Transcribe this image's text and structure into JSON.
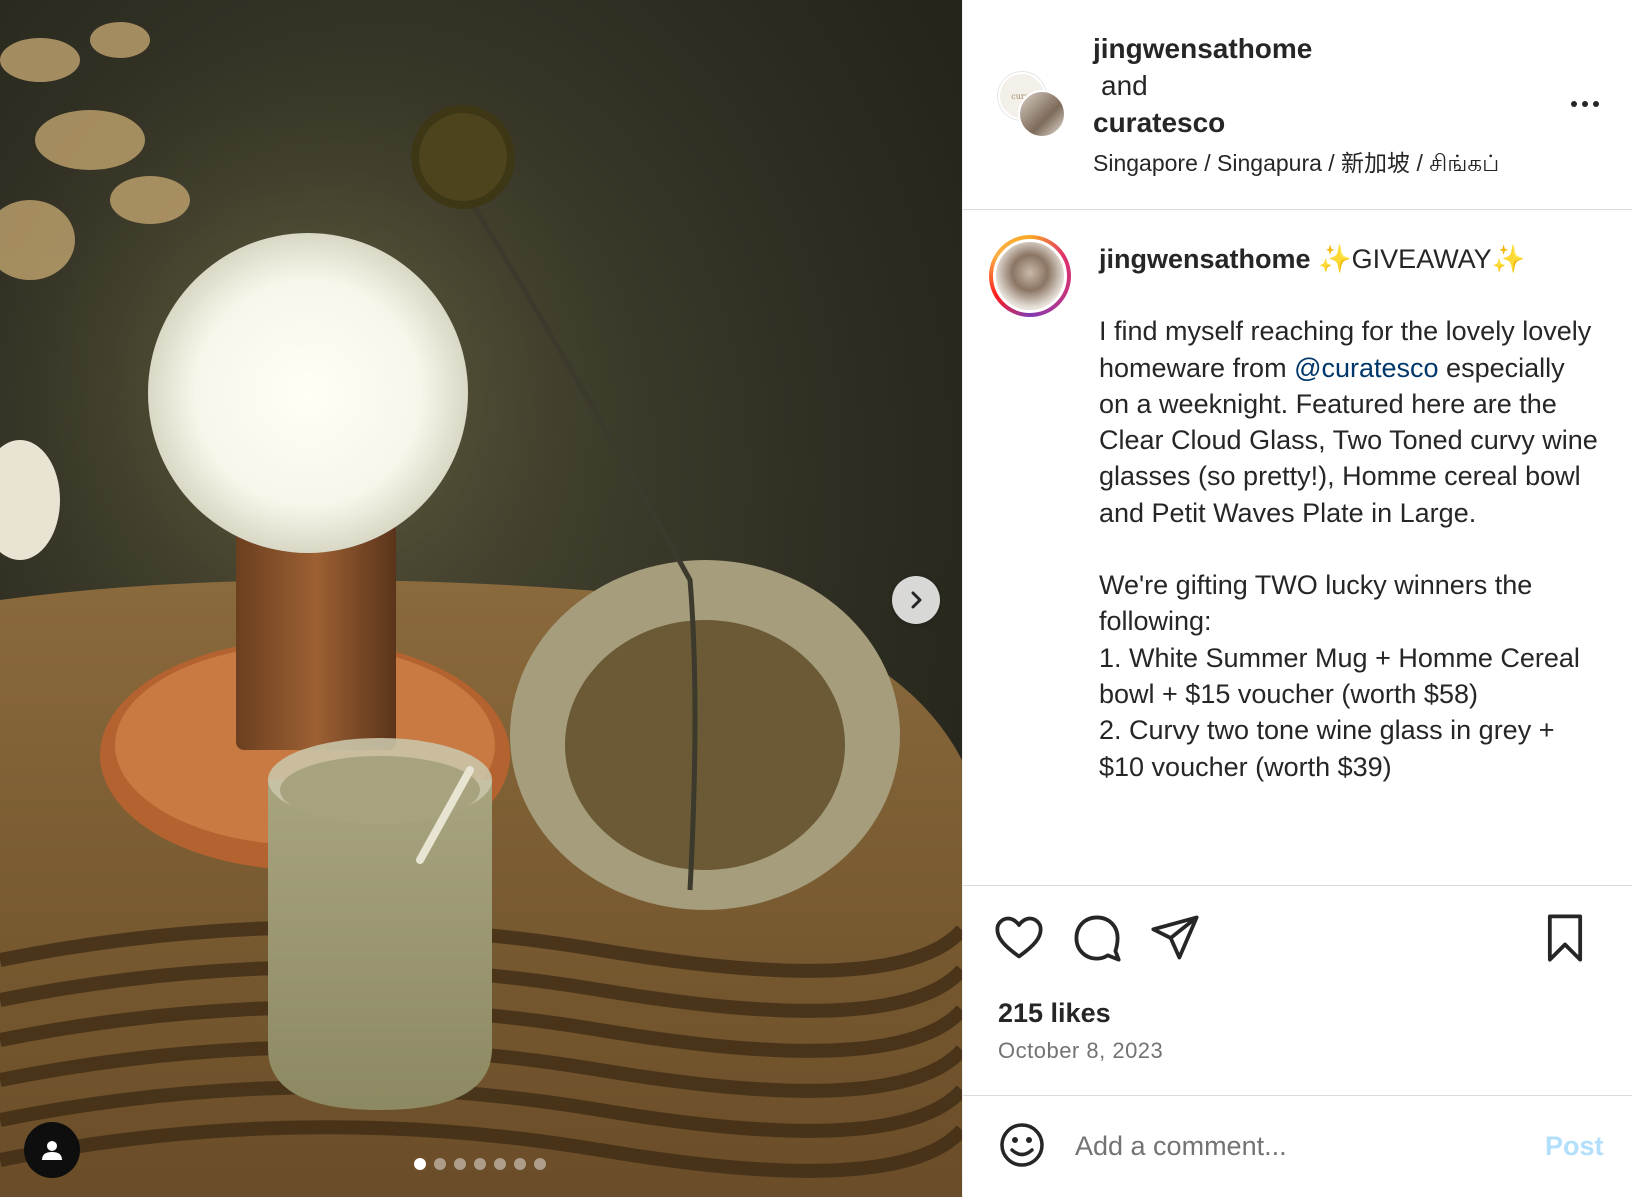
{
  "header": {
    "user1": "jingwensathome",
    "and_word": "and",
    "user2": "curatesco",
    "location": "Singapore / Singapura / 新加坡 / சிங்கப்",
    "more_icon": "more-horizontal-icon"
  },
  "media": {
    "slide_count": 7,
    "active_slide": 1,
    "next_icon": "chevron-right-icon",
    "tag_icon": "user-tag-icon"
  },
  "caption": {
    "username": "jingwensathome",
    "sparkle": "✨",
    "headline": "GIVEAWAY",
    "p1_a": "I find myself reaching for the lovely lovely homeware from ",
    "mention": "@curatesco",
    "p1_b": " especially on a weeknight. Featured here are the Clear Cloud Glass, Two Toned curvy wine glasses (so pretty!), Homme cereal bowl and Petit Waves Plate in Large.",
    "p2": "We're gifting TWO lucky winners the following:",
    "item1": "1. White Summer Mug + Homme Cereal bowl + $15 voucher (worth $58)",
    "item2": "2. Curvy two tone wine glass in grey + $10 voucher (worth $39)"
  },
  "actions": {
    "like_icon": "heart-icon",
    "comment_icon": "comment-icon",
    "share_icon": "share-icon",
    "save_icon": "bookmark-icon",
    "likes": "215 likes",
    "date": "October 8, 2023"
  },
  "comment": {
    "emoji_icon": "emoji-icon",
    "placeholder": "Add a comment...",
    "post_label": "Post",
    "post_color": "#b2dffc"
  },
  "colors": {
    "text": "#262626",
    "secondary": "#737373",
    "mention": "#00376b",
    "border": "#dbdbdb"
  }
}
